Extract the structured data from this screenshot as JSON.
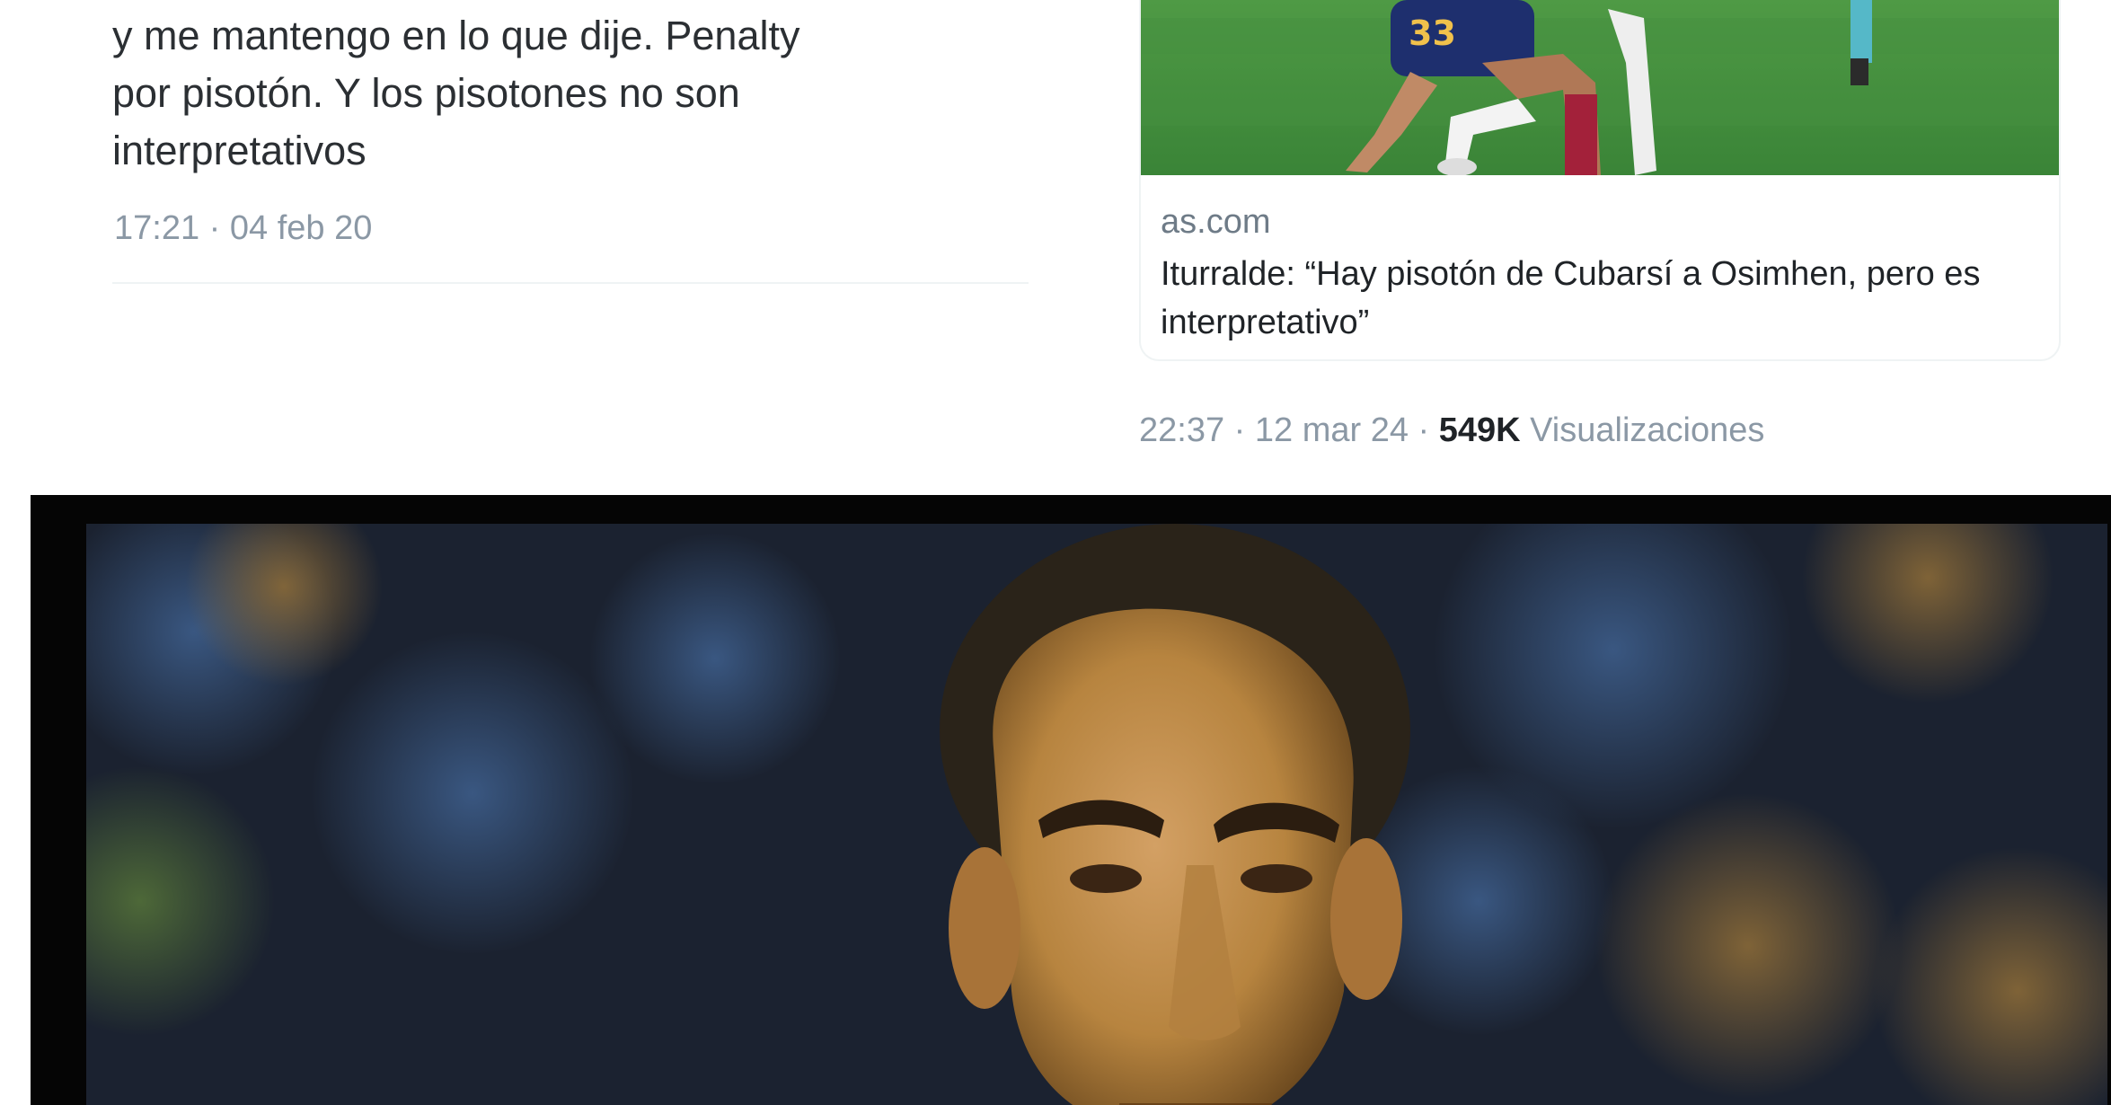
{
  "left_tweet": {
    "text_lines": [
      "y me mantengo en lo que dije. Penalty",
      "por pisotón. Y los pisotones no son",
      "interpretativos"
    ],
    "timestamp": "17:21 · 04 feb 20"
  },
  "right_tweet": {
    "link_card": {
      "domain": "as.com",
      "title": "Iturralde: “Hay pisotón de Cubarsí a Osimhen, pero es interpretativo”"
    },
    "timestamp": "22:37 · 12 mar 24 · ",
    "views_count": "549K",
    "views_label": " Visualizaciones"
  },
  "colors": {
    "text": "#2b2f33",
    "secondary": "#8b98a5",
    "divider": "#eff3f4",
    "pitch": "#3f8f3a"
  },
  "icons": [
    "card-photo-image",
    "referee-photo-image"
  ]
}
